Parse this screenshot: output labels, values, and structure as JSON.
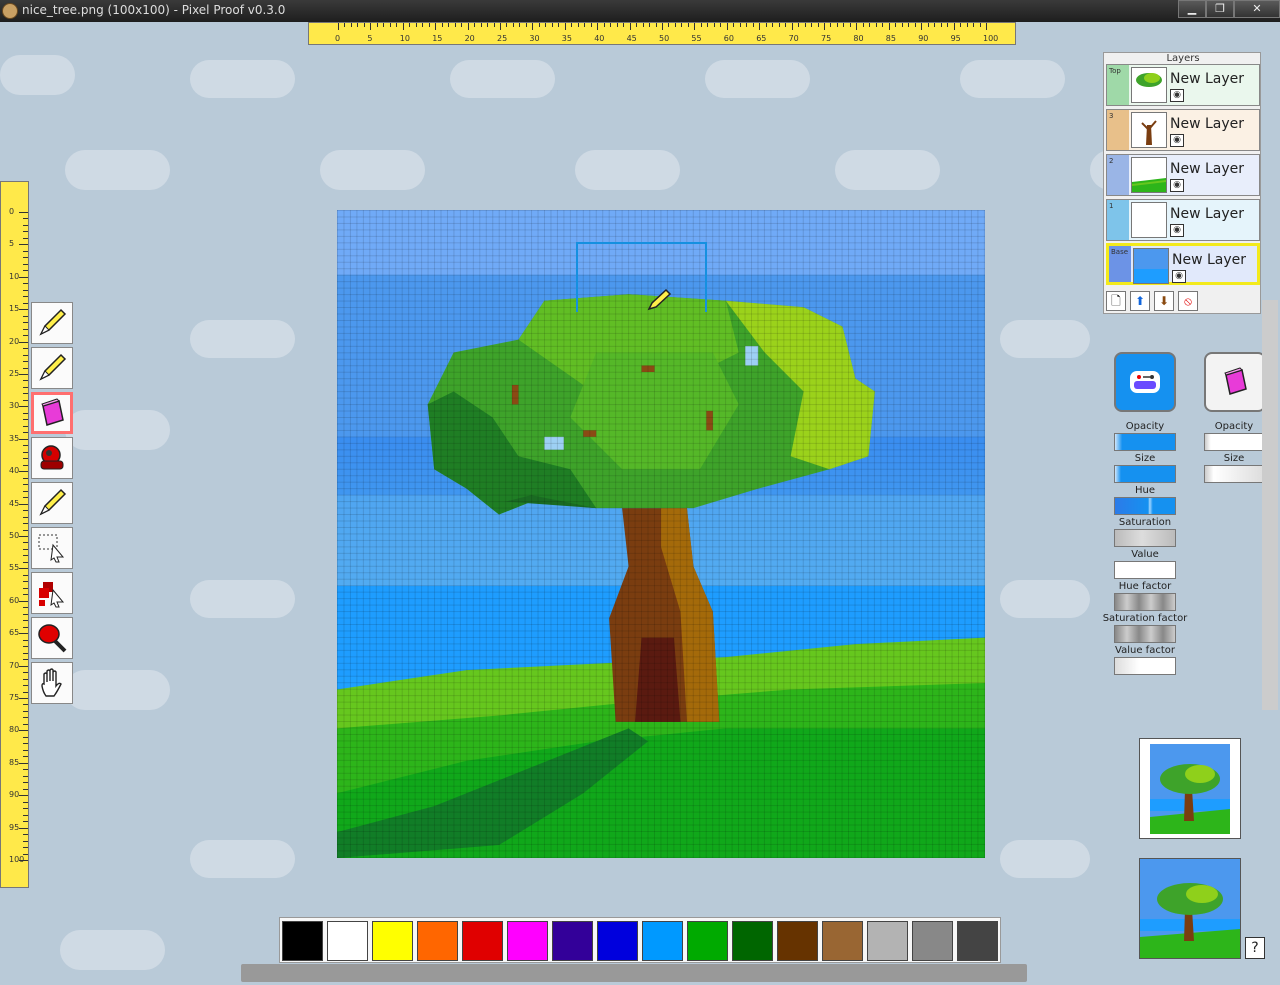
{
  "window": {
    "title": "nice_tree.png (100x100) - Pixel Proof v0.3.0",
    "buttons": [
      "▁",
      "❐",
      "✕"
    ]
  },
  "ruler": {
    "horizontal_labels": [
      "0",
      "5",
      "10",
      "15",
      "20",
      "25",
      "30",
      "35",
      "40",
      "45",
      "50",
      "55",
      "60",
      "65",
      "70",
      "75",
      "80",
      "85",
      "90",
      "95",
      "100"
    ],
    "vertical_labels": [
      "0",
      "5",
      "10",
      "15",
      "20",
      "25",
      "30",
      "35",
      "40",
      "45",
      "50",
      "55",
      "60",
      "65",
      "70",
      "75",
      "80",
      "85",
      "90",
      "95",
      "100"
    ]
  },
  "tools": [
    {
      "name": "pencil-tool-1",
      "icon": "pencil-icon"
    },
    {
      "name": "pencil-tool-2",
      "icon": "pencil-icon"
    },
    {
      "name": "eraser-tool",
      "icon": "eraser-icon",
      "selected": true
    },
    {
      "name": "color-picker-tool",
      "icon": "dropper-icon"
    },
    {
      "name": "pencil-tool-3",
      "icon": "pencil-icon"
    },
    {
      "name": "select-tool",
      "icon": "selection-icon"
    },
    {
      "name": "move-tool",
      "icon": "move-icon"
    },
    {
      "name": "fill-tool",
      "icon": "fill-icon"
    },
    {
      "name": "pan-tool",
      "icon": "hand-icon"
    }
  ],
  "layers": {
    "title": "Layers",
    "items": [
      {
        "tag": "Top",
        "name": "New Layer",
        "color": "#9fd9a8",
        "bg": "#eaf7ed",
        "visible": true
      },
      {
        "tag": "3",
        "name": "New Layer",
        "color": "#e8c08a",
        "bg": "#fbf1e4",
        "visible": true
      },
      {
        "tag": "2",
        "name": "New Layer",
        "color": "#9ab5e6",
        "bg": "#e8eefb",
        "visible": true
      },
      {
        "tag": "1",
        "name": "New Layer",
        "color": "#7ec4ea",
        "bg": "#e5f4fb",
        "visible": true
      },
      {
        "tag": "Base",
        "name": "New Layer",
        "color": "#6c93e6",
        "bg": "#e1e9fb",
        "visible": true,
        "selected": true
      }
    ],
    "actions": [
      {
        "name": "new-layer-button",
        "icon": "page-icon",
        "glyph": "🗋"
      },
      {
        "name": "move-layer-up-button",
        "icon": "arrow-up-icon",
        "glyph": "⬆"
      },
      {
        "name": "move-layer-down-button",
        "icon": "arrow-down-icon",
        "glyph": "⬇"
      },
      {
        "name": "delete-layer-button",
        "icon": "no-icon",
        "glyph": "⦸"
      }
    ]
  },
  "color_panel": {
    "primary": {
      "opacity_label": "Opacity",
      "size_label": "Size",
      "hue_label": "Hue",
      "saturation_label": "Saturation",
      "value_label": "Value",
      "hue_factor_label": "Hue factor",
      "saturation_factor_label": "Saturation factor",
      "value_factor_label": "Value factor"
    },
    "secondary": {
      "opacity_label": "Opacity",
      "size_label": "Size"
    }
  },
  "palette": {
    "colors": [
      "#000000",
      "#ffffff",
      "#ffff00",
      "#ff6600",
      "#e00000",
      "#ff00ff",
      "#330099",
      "#0000dd",
      "#0099ff",
      "#00aa00",
      "#006600",
      "#663300",
      "#996633",
      "#b3b3b3",
      "#888888",
      "#444444"
    ]
  },
  "help_label": "?",
  "colors": {
    "ruler": "#ffe94a",
    "selected_tool_border": "#ff6f6f",
    "selected_layer_border": "#f3ea1c",
    "accent_blue": "#1591f0"
  }
}
